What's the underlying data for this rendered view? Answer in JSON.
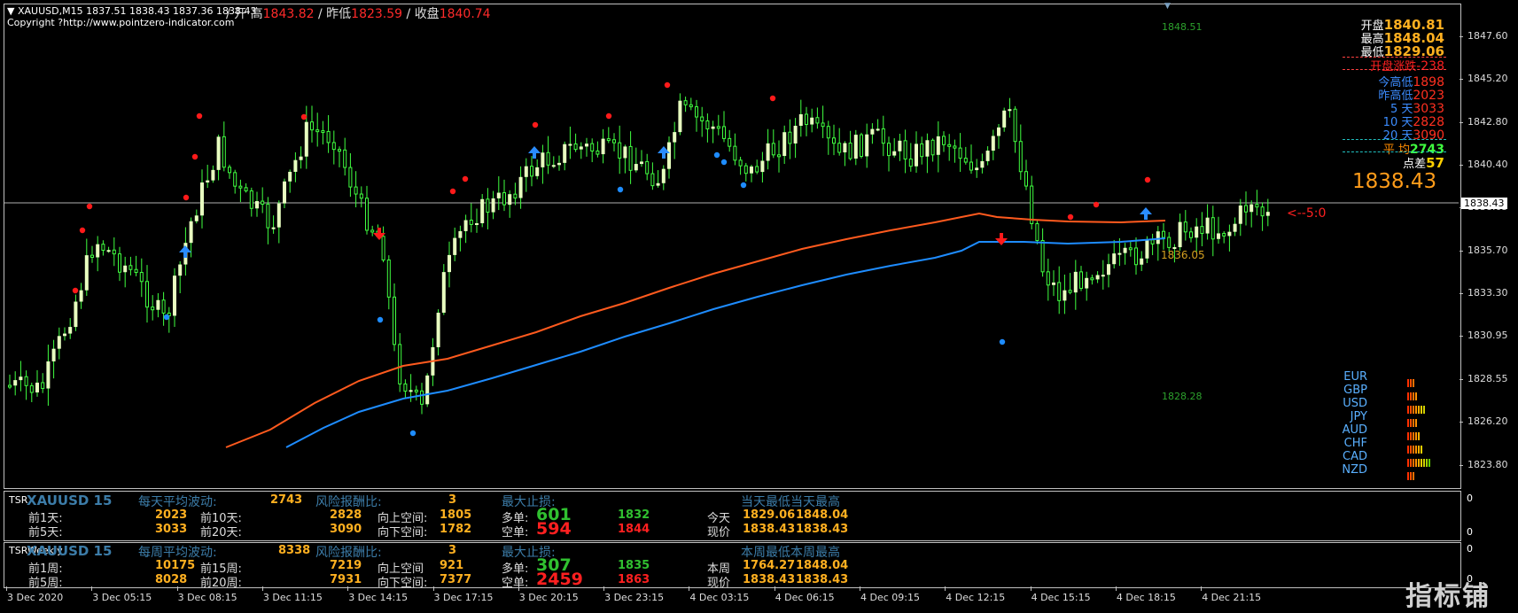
{
  "header": {
    "symbol_line": "XAUUSD,M15  1837.51 1838.43 1837.36 1838.43",
    "copyright": "Copyright ?http://www.pointzero-indicator.com",
    "ticker_labels": [
      "开盘",
      "昨低",
      "收盘"
    ],
    "ticker_values": [
      "1843.82",
      "1823.59",
      "1840.74"
    ],
    "ticker_prefix": "/ 开 高",
    "sep1": "/",
    "sep2": "/"
  },
  "chart_labels": {
    "top_price": "1848.51",
    "bottom_price": "1828.28",
    "mid_price": "1836.05",
    "signal": "<--5:0"
  },
  "right_info": {
    "rows": [
      {
        "label": "开盘",
        "value": "1840.81",
        "label_color": "#ffffff",
        "value_color": "#ffb020"
      },
      {
        "label": "最高",
        "value": "1848.04",
        "label_color": "#ffffff",
        "value_color": "#ffb020"
      },
      {
        "label": "最低",
        "value": "1829.06",
        "label_color": "#ffffff",
        "value_color": "#ffb020"
      },
      {
        "label": "开盘涨跌",
        "value": "-238",
        "label_color": "#ff2020",
        "value_color": "#ff2020"
      },
      {
        "label": "今高低",
        "value": "1898",
        "label_color": "#3c8cff",
        "value_color": "#ff3020"
      },
      {
        "label": "昨高低",
        "value": "2023",
        "label_color": "#3c8cff",
        "value_color": "#ff3020"
      },
      {
        "label": "5  天",
        "value": "3033",
        "label_color": "#3c8cff",
        "value_color": "#ff3020"
      },
      {
        "label": "10  天",
        "value": "2828",
        "label_color": "#3c8cff",
        "value_color": "#ff3020"
      },
      {
        "label": "20  天",
        "value": "3090",
        "label_color": "#3c8cff",
        "value_color": "#ff3020"
      },
      {
        "label": "平  均",
        "value": "2743",
        "label_color": "#ff8c00",
        "value_color": "#40ff40"
      },
      {
        "label": "点差",
        "value": "57",
        "label_color": "#ffffff",
        "value_color": "#ffd000"
      }
    ],
    "current_price": "1838.43"
  },
  "price_axis": {
    "ticks": [
      "1847.60",
      "1845.20",
      "1842.80",
      "1840.40",
      "1838.05",
      "1835.70",
      "1833.30",
      "1830.95",
      "1828.55",
      "1826.20",
      "1823.80"
    ],
    "current_label": "1838.43"
  },
  "currency_strength": [
    {
      "name": "EUR",
      "bars": [
        "#ff3000",
        "#ff5000",
        "#ff7000"
      ]
    },
    {
      "name": "GBP",
      "bars": [
        "#ff3000",
        "#ff5000",
        "#ff7000",
        "#ff9000"
      ]
    },
    {
      "name": "USD",
      "bars": [
        "#ff3000",
        "#ff5000",
        "#ff7000",
        "#ff9000",
        "#ffb000",
        "#ffd000",
        "#d0d000"
      ]
    },
    {
      "name": "JPY",
      "bars": [
        "#ff3000",
        "#ff5000",
        "#ff7000",
        "#ff9000"
      ]
    },
    {
      "name": "AUD",
      "bars": [
        "#ff3000",
        "#ff5000",
        "#ff7000",
        "#ff9000",
        "#ffb000"
      ]
    },
    {
      "name": "CHF",
      "bars": [
        "#ff3000",
        "#ff5000",
        "#ff7000",
        "#ff9000",
        "#ffb000",
        "#ffd000"
      ]
    },
    {
      "name": "CAD",
      "bars": [
        "#ff3000",
        "#ff5000",
        "#ff7000",
        "#ff9000",
        "#ffb000",
        "#ffd000",
        "#d0d000",
        "#a0d000",
        "#60d000"
      ]
    },
    {
      "name": "NZD",
      "bars": [
        "#ff3000",
        "#ff5000",
        "#ff7000"
      ]
    }
  ],
  "time_axis": [
    "3 Dec 2020",
    "3 Dec 05:15",
    "3 Dec 08:15",
    "3 Dec 11:15",
    "3 Dec 14:15",
    "3 Dec 17:15",
    "3 Dec 20:15",
    "3 Dec 23:15",
    "4 Dec 03:15",
    "4 Dec 06:15",
    "4 Dec 09:15",
    "4 Dec 12:15",
    "4 Dec 15:15",
    "4 Dec 18:15",
    "4 Dec 21:15"
  ],
  "panel1": {
    "name": "TSR",
    "symbol": "XAUUSD 15",
    "avg_label": "每天平均波动:",
    "avg_value": "2743",
    "risk_label": "风险报酬比:",
    "risk_value": "3",
    "maxstop_label": "最大止损:",
    "range_label": "当天最低当天最高",
    "row1_label": "前1天:",
    "row1_value": "2023",
    "row1_label2": "前10天:",
    "row1_value2": "2828",
    "row1_dir": "向上空间:",
    "row1_dirval": "1805",
    "row1_order": "多单:",
    "row1_ordval": "601",
    "row1_tgt": "1832",
    "row1_day": "今天",
    "row1_lo": "1829.06",
    "row1_hi": "1848.04",
    "row2_label": "前5天:",
    "row2_value": "3033",
    "row2_label2": "前20天:",
    "row2_value2": "3090",
    "row2_dir": "向下空间:",
    "row2_dirval": "1782",
    "row2_order": "空单:",
    "row2_ordval": "594",
    "row2_tgt": "1844",
    "row2_day": "现价",
    "row2_lo": "1838.43",
    "row2_hi": "1838.43",
    "scale_top": "0",
    "scale_bot": "0"
  },
  "panel2": {
    "name": "TSRWeekly",
    "symbol": "XAUUSD 15",
    "avg_label": "每周平均波动:",
    "avg_value": "8338",
    "risk_label": "风险报酬比:",
    "risk_value": "3",
    "maxstop_label": "最大止损:",
    "range_label": "本周最低本周最高",
    "row1_label": "前1周:",
    "row1_value": "10175",
    "row1_label2": "前15周:",
    "row1_value2": "7219",
    "row1_dir": "向上空间",
    "row1_dirval": "921",
    "row1_order": "多单:",
    "row1_ordval": "307",
    "row1_tgt": "1835",
    "row1_day": "本周",
    "row1_lo": "1764.27",
    "row1_hi": "1848.04",
    "row2_label": "前5周:",
    "row2_value": "8028",
    "row2_label2": "前20周:",
    "row2_value2": "7931",
    "row2_dir": "向下空间:",
    "row2_dirval": "7377",
    "row2_order": "空单:",
    "row2_ordval": "2459",
    "row2_tgt": "1863",
    "row2_day": "现价",
    "row2_lo": "1838.43",
    "row2_hi": "1838.43",
    "scale_top": "0",
    "scale_bot": "0"
  },
  "watermark": "指标铺",
  "colors": {
    "candle": "#40ff40",
    "candle_body": "#e8ffc0",
    "ma_orange": "#ff5a1e",
    "ma_blue": "#1e8cff",
    "grid_frame": "#c0c0c0"
  }
}
